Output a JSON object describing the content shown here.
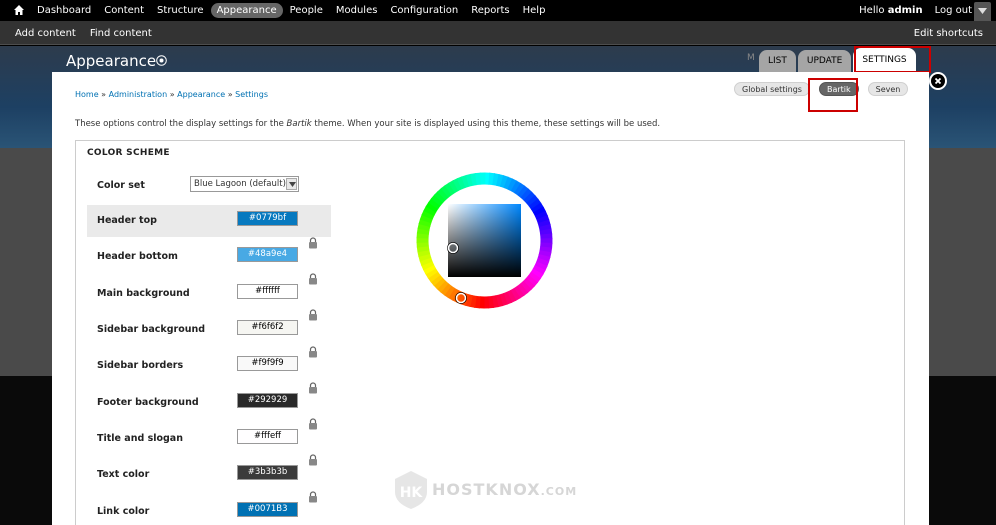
{
  "toolbar": {
    "items": [
      "Dashboard",
      "Content",
      "Structure",
      "Appearance",
      "People",
      "Modules",
      "Configuration",
      "Reports",
      "Help"
    ],
    "active": "Appearance",
    "hello": "Hello",
    "username": "admin",
    "logout": "Log out"
  },
  "shortcuts": {
    "links": [
      "Add content",
      "Find content"
    ],
    "edit": "Edit shortcuts"
  },
  "overlay": {
    "title": "Appearance",
    "tabs": [
      "LIST",
      "UPDATE",
      "SETTINGS"
    ],
    "active_tab": "SETTINGS",
    "breadcrumb": [
      "Home",
      "Administration",
      "Appearance",
      "Settings"
    ],
    "subtabs": [
      "Global settings",
      "Bartik",
      "Seven"
    ],
    "active_subtab": "Bartik",
    "intro_before": "These options control the display settings for the ",
    "intro_theme": "Bartik",
    "intro_after": " theme. When your site is displayed using this theme, these settings will be used."
  },
  "color_scheme": {
    "legend": "COLOR SCHEME",
    "color_set_label": "Color set",
    "color_set_value": "Blue Lagoon (default)",
    "fields": [
      {
        "label": "Header top",
        "value": "#0779bf",
        "bg": "#0779bf",
        "fg": "#ffffff"
      },
      {
        "label": "Header bottom",
        "value": "#48a9e4",
        "bg": "#48a9e4",
        "fg": "#ffffff"
      },
      {
        "label": "Main background",
        "value": "#ffffff",
        "bg": "#ffffff",
        "fg": "#000000"
      },
      {
        "label": "Sidebar background",
        "value": "#f6f6f2",
        "bg": "#f6f6f2",
        "fg": "#000000"
      },
      {
        "label": "Sidebar borders",
        "value": "#f9f9f9",
        "bg": "#f9f9f9",
        "fg": "#000000"
      },
      {
        "label": "Footer background",
        "value": "#292929",
        "bg": "#292929",
        "fg": "#ffffff"
      },
      {
        "label": "Title and slogan",
        "value": "#fffeff",
        "bg": "#fffeff",
        "fg": "#000000"
      },
      {
        "label": "Text color",
        "value": "#3b3b3b",
        "bg": "#3b3b3b",
        "fg": "#ffffff"
      },
      {
        "label": "Link color",
        "value": "#0071B3",
        "bg": "#0071b3",
        "fg": "#ffffff"
      }
    ],
    "selected_field": "Header top"
  },
  "watermark": {
    "text": "HOSTKNOX",
    "domain": ".COM"
  }
}
